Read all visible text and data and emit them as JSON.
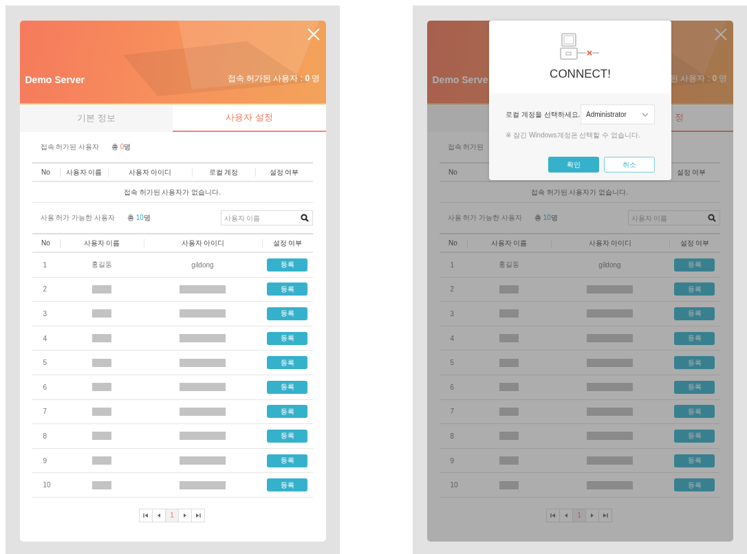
{
  "screens": [
    {
      "dimmed": false,
      "header": {
        "title": "Demo Server",
        "count_text": "접속 허가된 사용자 : **0** 명"
      },
      "tabs": [
        {
          "label": "기본 정보",
          "selected": false
        },
        {
          "label": "사용자 설정",
          "selected": true
        }
      ],
      "granted": {
        "label": "접속 허가된 사용자",
        "total_prefix": "총 ",
        "total": "0",
        "total_unit": "명",
        "columns": [
          {
            "label": "No"
          },
          {
            "label": "사용자 이름"
          },
          {
            "label": "사용자 아이디"
          },
          {
            "label": "로컬 계정"
          },
          {
            "label": "설정 여부"
          }
        ],
        "empty_message": "접속 허가된 사용자가 없습니다."
      },
      "available": {
        "label": "사용 허가 가능한 사용자",
        "total_prefix": "총 ",
        "total": "10",
        "total_unit": "명",
        "search": {
          "placeholder": "사용자 이름"
        },
        "columns": [
          {
            "label": "No"
          },
          {
            "label": "사용자 이름"
          },
          {
            "label": "사용자 아이디"
          },
          {
            "label": "설정 여부"
          }
        ],
        "rows": [
          {
            "no": "1",
            "name": "홍길동",
            "user_id": "gildong",
            "redacted": false,
            "button": "등록"
          },
          {
            "no": "2",
            "redacted": true,
            "button": "등록"
          },
          {
            "no": "3",
            "redacted": true,
            "button": "등록"
          },
          {
            "no": "4",
            "redacted": true,
            "button": "등록"
          },
          {
            "no": "5",
            "redacted": true,
            "button": "등록"
          },
          {
            "no": "6",
            "redacted": true,
            "button": "등록"
          },
          {
            "no": "7",
            "redacted": true,
            "button": "등록"
          },
          {
            "no": "8",
            "redacted": true,
            "button": "등록"
          },
          {
            "no": "9",
            "redacted": true,
            "button": "등록"
          },
          {
            "no": "10",
            "redacted": true,
            "button": "등록"
          }
        ]
      },
      "pagination": {
        "pages": [
          {
            "label": "1",
            "selected": true
          }
        ]
      }
    },
    {
      "dimmed": true,
      "header": {
        "title": "Demo Serve",
        "count_text": "된 사용자 : **0** 명"
      },
      "tabs": [
        {
          "selected": false
        },
        {
          "label": "정",
          "selected": true
        }
      ],
      "granted": {
        "label": "접속 허가된",
        "columns": [
          {
            "label": "No"
          },
          {},
          {},
          {},
          {
            "label": "설정 여부"
          }
        ],
        "empty_message": "접속 허가된 사용자가 없습니다."
      },
      "available": {
        "label": "사용 허가 가능한 사용자",
        "total_prefix": "총 ",
        "total": "10",
        "total_unit": "명",
        "search": {
          "placeholder": "사용자 이름"
        },
        "columns": [
          {
            "label": "No"
          },
          {
            "label": "사용자 이름"
          },
          {
            "label": "사용자 아이디"
          },
          {
            "label": "설정 여부"
          }
        ],
        "rows": [
          {
            "no": "1",
            "name": "홍길동",
            "user_id": "gildong",
            "redacted": false,
            "button": "등록"
          },
          {
            "no": "2",
            "redacted": true,
            "button": "등록"
          },
          {
            "no": "3",
            "redacted": true,
            "button": "등록"
          },
          {
            "no": "4",
            "redacted": true,
            "button": "등록"
          },
          {
            "no": "5",
            "redacted": true,
            "button": "등록"
          },
          {
            "no": "6",
            "redacted": true,
            "button": "등록"
          },
          {
            "no": "7",
            "redacted": true,
            "button": "등록"
          },
          {
            "no": "8",
            "redacted": true,
            "button": "등록"
          },
          {
            "no": "9",
            "redacted": true,
            "button": "등록"
          },
          {
            "no": "10",
            "redacted": true,
            "button": "등록"
          }
        ]
      },
      "pagination": {
        "pages": [
          {
            "label": "1",
            "selected": true
          }
        ]
      },
      "dialog": {
        "title": "CONNECT!",
        "field_label": "로컬 계정을 선택하세요.",
        "select_value": "Administrator",
        "note": "※ 잠긴 Windows계정은 선택할 수 없습니다.",
        "buttons": [
          {
            "label": "확인",
            "kind": "primary"
          },
          {
            "label": "취소",
            "kind": "secondary"
          }
        ]
      }
    }
  ]
}
